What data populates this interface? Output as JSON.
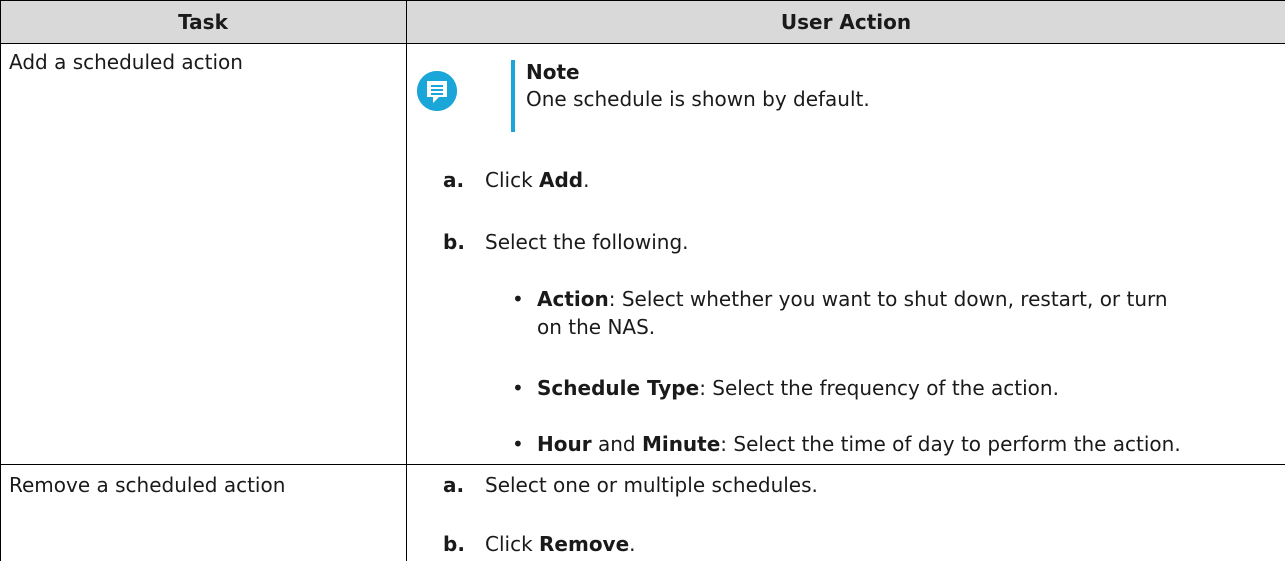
{
  "table": {
    "headers": {
      "task": "Task",
      "user_action": "User Action"
    },
    "rows": [
      {
        "task": "Add a scheduled action",
        "note": {
          "title": "Note",
          "body": "One schedule is shown by default."
        },
        "steps": [
          {
            "marker": "a.",
            "pre": "Click ",
            "bold": "Add",
            "post": "."
          },
          {
            "marker": "b.",
            "text": "Select the following."
          }
        ],
        "bullets": [
          {
            "bold": "Action",
            "text": ": Select whether you want to shut down, restart, or turn",
            "text2": "on the NAS."
          },
          {
            "bold": "Schedule Type",
            "text": ": Select the frequency of the action."
          },
          {
            "bold": "Hour",
            "mid": " and ",
            "bold2": "Minute",
            "text": ": Select the time of day to perform the action."
          }
        ]
      },
      {
        "task": "Remove a scheduled action",
        "steps": [
          {
            "marker": "a.",
            "text": "Select one or multiple schedules."
          },
          {
            "marker": "b.",
            "pre": "Click ",
            "bold": "Remove",
            "post": "."
          }
        ]
      }
    ]
  },
  "colors": {
    "header_bg": "#d9d9d9",
    "note_accent": "#1aa6d8",
    "border": "#000000"
  },
  "icons": {
    "note": "note-icon"
  }
}
